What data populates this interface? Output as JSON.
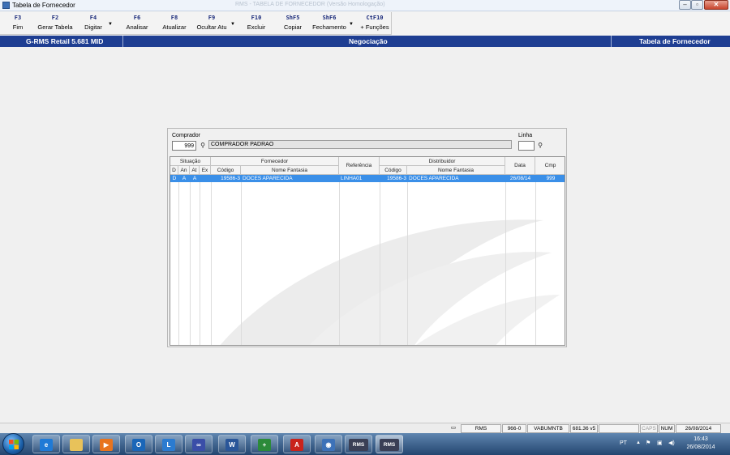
{
  "window": {
    "title": "Tabela de Fornecedor",
    "ghost_title": "RMS - TABELA DE FORNECEDOR (Versão Homologação)"
  },
  "toolbar": [
    {
      "key": "F3",
      "label": "Fim"
    },
    {
      "key": "F2",
      "label": "Gerar Tabela"
    },
    {
      "key": "F4",
      "label": "Digitar"
    },
    {
      "key": "F6",
      "label": "Analisar"
    },
    {
      "key": "F8",
      "label": "Atualizar"
    },
    {
      "key": "F9",
      "label": "Ocultar Atu"
    },
    {
      "key": "F10",
      "label": "Excluir"
    },
    {
      "key": "ShF5",
      "label": "Copiar"
    },
    {
      "key": "ShF6",
      "label": "Fechamento"
    },
    {
      "key": "CtF10",
      "label": "+ Funções"
    }
  ],
  "header": {
    "left": "G-RMS Retail 5.681 MID",
    "center": "Negociação",
    "right": "Tabela de Fornecedor"
  },
  "form": {
    "comprador_label": "Comprador",
    "comprador_code": "999",
    "comprador_name": "COMPRADOR PADRAO",
    "linha_label": "Linha",
    "linha_value": ""
  },
  "grid": {
    "groups": {
      "situacao": "Situação",
      "fornecedor": "Fornecedor",
      "referencia": "Referência",
      "distribuidor": "Distribuidor",
      "data": "Data",
      "cmp": "Cmp"
    },
    "columns": {
      "d": "D",
      "an": "An",
      "at": "At",
      "ex": "Ex",
      "forn_codigo": "Código",
      "forn_nome": "Nome Fantasia",
      "dist_codigo": "Código",
      "dist_nome": "Nome Fantasia"
    },
    "rows": [
      {
        "d": "D",
        "an": "A",
        "at": "A",
        "ex": "",
        "forn_codigo": "19586-3",
        "forn_nome": "DOCES APARECIDA",
        "referencia": "LINHA01",
        "dist_codigo": "19586-3",
        "dist_nome": "DOCES APARECIDA",
        "data": "26/08/14",
        "cmp": "999"
      }
    ]
  },
  "statusbar": {
    "app": "RMS",
    "code": "966-0",
    "user": "VABUMNTB",
    "version": "681.36 v5",
    "caps": "CAPS",
    "num": "NUM",
    "date": "26/08/2014"
  },
  "taskbar": {
    "tasks": [
      "ie-icon",
      "explorer-icon",
      "media-player-icon",
      "outlook-icon",
      "lync-icon",
      "network-icon",
      "word-icon",
      "plus-icon",
      "acrobat-icon",
      "remote-icon",
      "rms-icon",
      "rms-icon"
    ],
    "rms_label": "RMS",
    "lang": "PT",
    "time": "16:43",
    "date": "26/08/2014"
  }
}
